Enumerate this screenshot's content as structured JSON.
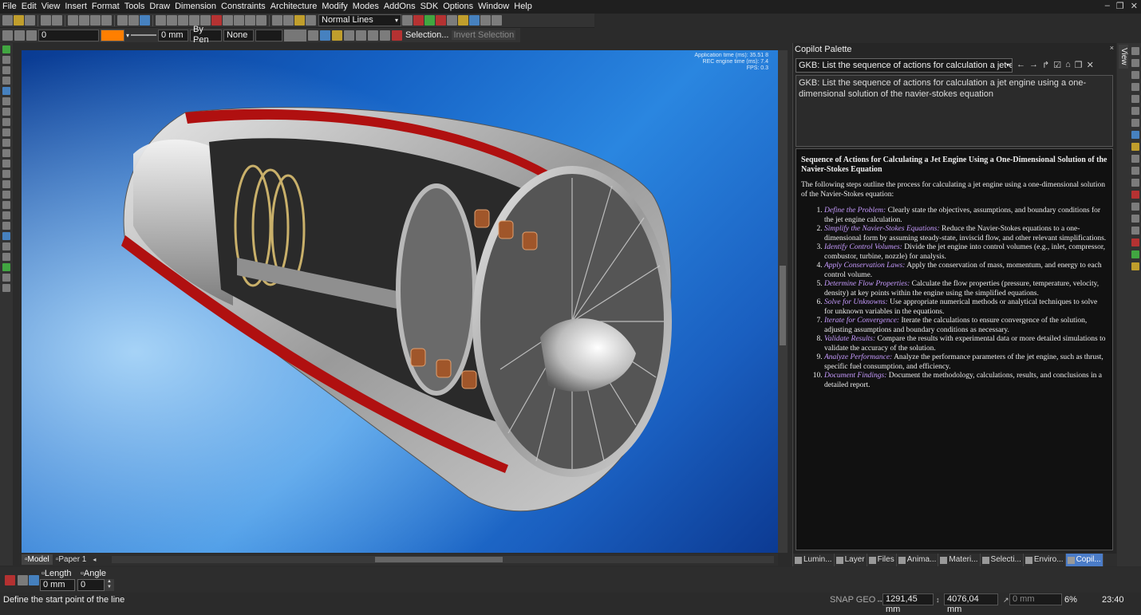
{
  "menu": [
    "File",
    "Edit",
    "View",
    "Insert",
    "Format",
    "Tools",
    "Draw",
    "Dimension",
    "Constraints",
    "Architecture",
    "Modify",
    "Modes",
    "AddOns",
    "SDK",
    "Options",
    "Window",
    "Help"
  ],
  "toolbar": {
    "line_style": "Normal Lines",
    "line_width": "0",
    "line_thickness": "0 mm",
    "by_pen": "By Pen",
    "none": "None",
    "selection_label": "Selection...",
    "invert_selection_label": "Invert Selection",
    "color": "#ff7f00"
  },
  "viewport": {
    "perf_lines": [
      "Application time (ms): 35.51 8",
      "REC engine time (ms): 7.4",
      "FPS: 0.3"
    ]
  },
  "bottom_tabs": [
    "Model",
    "Paper 1"
  ],
  "palette": {
    "title": "Copilot Palette",
    "query_combo": "GKB: List the sequence of actions for calculation a jet en",
    "prompt_text": "GKB: List the sequence of actions for calculation a jet engine using a one-dimensional solution of the navier-stokes equation",
    "answer_title": "Sequence of Actions for Calculating a Jet Engine Using a One-Dimensional Solution of the Navier-Stokes Equation",
    "answer_intro": "The following steps outline the process for calculating a jet engine using a one-dimensional solution of the Navier-Stokes equation:",
    "steps": [
      {
        "key": "Define the Problem:",
        "text": " Clearly state the objectives, assumptions, and boundary conditions for the jet engine calculation."
      },
      {
        "key": "Simplify the Navier-Stokes Equations:",
        "text": " Reduce the Navier-Stokes equations to a one-dimensional form by assuming steady-state, inviscid flow, and other relevant simplifications."
      },
      {
        "key": "Identify Control Volumes:",
        "text": " Divide the jet engine into control volumes (e.g., inlet, compressor, combustor, turbine, nozzle) for analysis."
      },
      {
        "key": "Apply Conservation Laws:",
        "text": " Apply the conservation of mass, momentum, and energy to each control volume."
      },
      {
        "key": "Determine Flow Properties:",
        "text": " Calculate the flow properties (pressure, temperature, velocity, density) at key points within the engine using the simplified equations."
      },
      {
        "key": "Solve for Unknowns:",
        "text": " Use appropriate numerical methods or analytical techniques to solve for unknown variables in the equations."
      },
      {
        "key": "Iterate for Convergence:",
        "text": " Iterate the calculations to ensure convergence of the solution, adjusting assumptions and boundary conditions as necessary."
      },
      {
        "key": "Validate Results:",
        "text": " Compare the results with experimental data or more detailed simulations to validate the accuracy of the solution."
      },
      {
        "key": "Analyze Performance:",
        "text": " Analyze the performance parameters of the jet engine, such as thrust, specific fuel consumption, and efficiency."
      },
      {
        "key": "Document Findings:",
        "text": " Document the methodology, calculations, results, and conclusions in a detailed report."
      }
    ],
    "tabs": [
      "Lumin...",
      "Layer",
      "Files",
      "Anima...",
      "Materi...",
      "Selecti...",
      "Enviro...",
      "Copil..."
    ],
    "side_tab": "View"
  },
  "command": {
    "length_label": "Length",
    "angle_label": "Angle",
    "length_value": "0 mm",
    "angle_value": "0"
  },
  "status": {
    "prompt": "Define the start point of the line",
    "snap": "SNAP GEO",
    "x": "1291,45 mm",
    "y": "4076,04 mm",
    "z": "0 mm",
    "zoom": "6%",
    "time": "23:40"
  }
}
